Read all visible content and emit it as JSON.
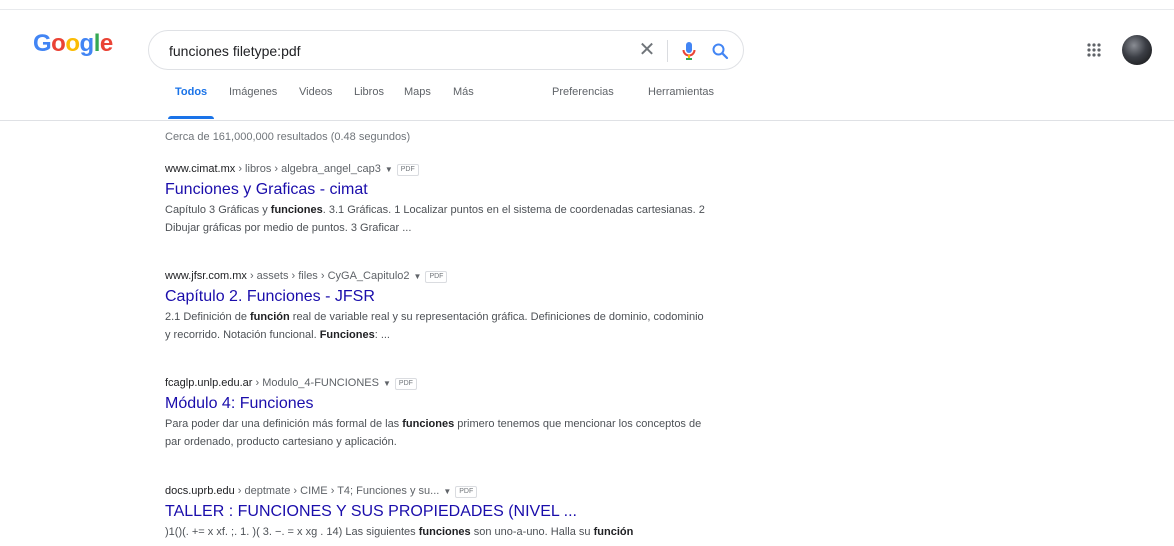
{
  "logo": {
    "letters": [
      "G",
      "o",
      "o",
      "g",
      "l",
      "e"
    ],
    "colors": [
      "#4285f4",
      "#ea4335",
      "#fbbc05",
      "#4285f4",
      "#34a853",
      "#ea4335"
    ]
  },
  "search": {
    "value": "funciones filetype:pdf",
    "clear_icon": "close-icon",
    "mic_icon": "microphone-icon",
    "search_icon": "magnifier-icon"
  },
  "tabs": [
    {
      "label": "Todos",
      "active": true
    },
    {
      "label": "Imágenes"
    },
    {
      "label": "Videos"
    },
    {
      "label": "Libros"
    },
    {
      "label": "Maps"
    },
    {
      "label": "Más"
    },
    {
      "label": "Preferencias"
    },
    {
      "label": "Herramientas"
    }
  ],
  "results_count": "Cerca de 161,000,000 resultados (0.48 segundos)",
  "results": [
    {
      "domain": "www.cimat.mx",
      "path": " › libros › algebra_angel_cap3",
      "badge": "PDF",
      "title": "Funciones y Graficas - cimat",
      "snippet": [
        [
          "Capítulo 3 Gráficas y ",
          false
        ],
        [
          "funciones",
          true
        ],
        [
          ". 3.1 Gráficas. 1 Localizar puntos en el sistema de coordenadas cartesianas. 2 Dibujar gráficas por medio de puntos. 3 Graficar ...",
          false
        ]
      ]
    },
    {
      "domain": "www.jfsr.com.mx",
      "path": " › assets › files › CyGA_Capitulo2",
      "badge": "PDF",
      "title": "Capítulo 2. Funciones - JFSR",
      "snippet": [
        [
          "2.1 Definición de ",
          false
        ],
        [
          "función",
          true
        ],
        [
          " real de variable real y su representación gráfica. Definiciones de dominio, codominio y recorrido. Notación funcional. ",
          false
        ],
        [
          "Funciones",
          true
        ],
        [
          ": ...",
          false
        ]
      ]
    },
    {
      "domain": "fcaglp.unlp.edu.ar",
      "path": " › Modulo_4-FUNCIONES",
      "badge": "PDF",
      "title": "Módulo 4: Funciones",
      "snippet": [
        [
          "Para poder dar una definición más formal de las ",
          false
        ],
        [
          "funciones",
          true
        ],
        [
          " primero tenemos que mencionar los conceptos de par ordenado, producto cartesiano y aplicación.",
          false
        ]
      ]
    },
    {
      "domain": "docs.uprb.edu",
      "path": " › deptmate › CIME › T4; Funciones y su...",
      "badge": "PDF",
      "title": "TALLER : FUNCIONES Y SUS PROPIEDADES (NIVEL ...",
      "snippet": [
        [
          ")1()(. += x xf. ;. 1. )( 3. −. = x xg . 14) Las siguientes ",
          false
        ],
        [
          "funciones",
          true
        ],
        [
          " son uno-a-uno. Halla su ",
          false
        ],
        [
          "función",
          true
        ]
      ]
    }
  ]
}
